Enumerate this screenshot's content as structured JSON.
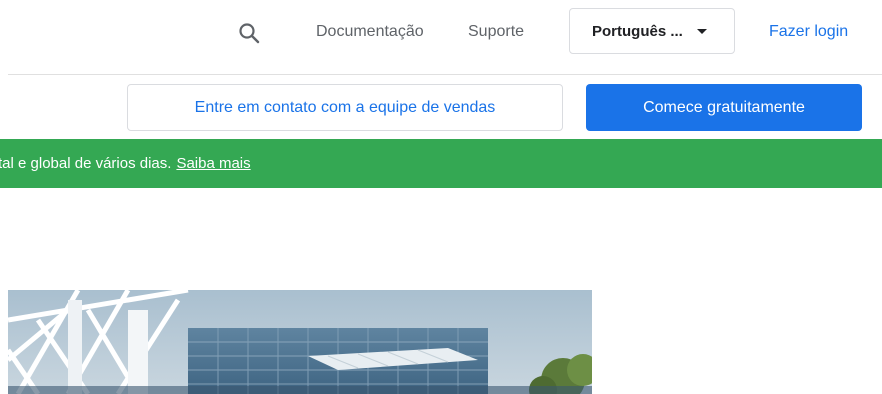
{
  "header": {
    "search_icon": "search-icon",
    "nav": {
      "documentation": "Documentação",
      "support": "Suporte"
    },
    "language": {
      "selected": "Português ...",
      "icon": "caret-down-icon"
    },
    "login": "Fazer login"
  },
  "actions": {
    "contact_sales": "Entre em contato com a equipe de vendas",
    "get_started": "Comece gratuitamente"
  },
  "banner": {
    "text": "tal e global de vários dias.",
    "link": "Saiba mais",
    "color": "#34a853"
  },
  "colors": {
    "accent": "#1a73e8",
    "banner": "#34a853"
  }
}
